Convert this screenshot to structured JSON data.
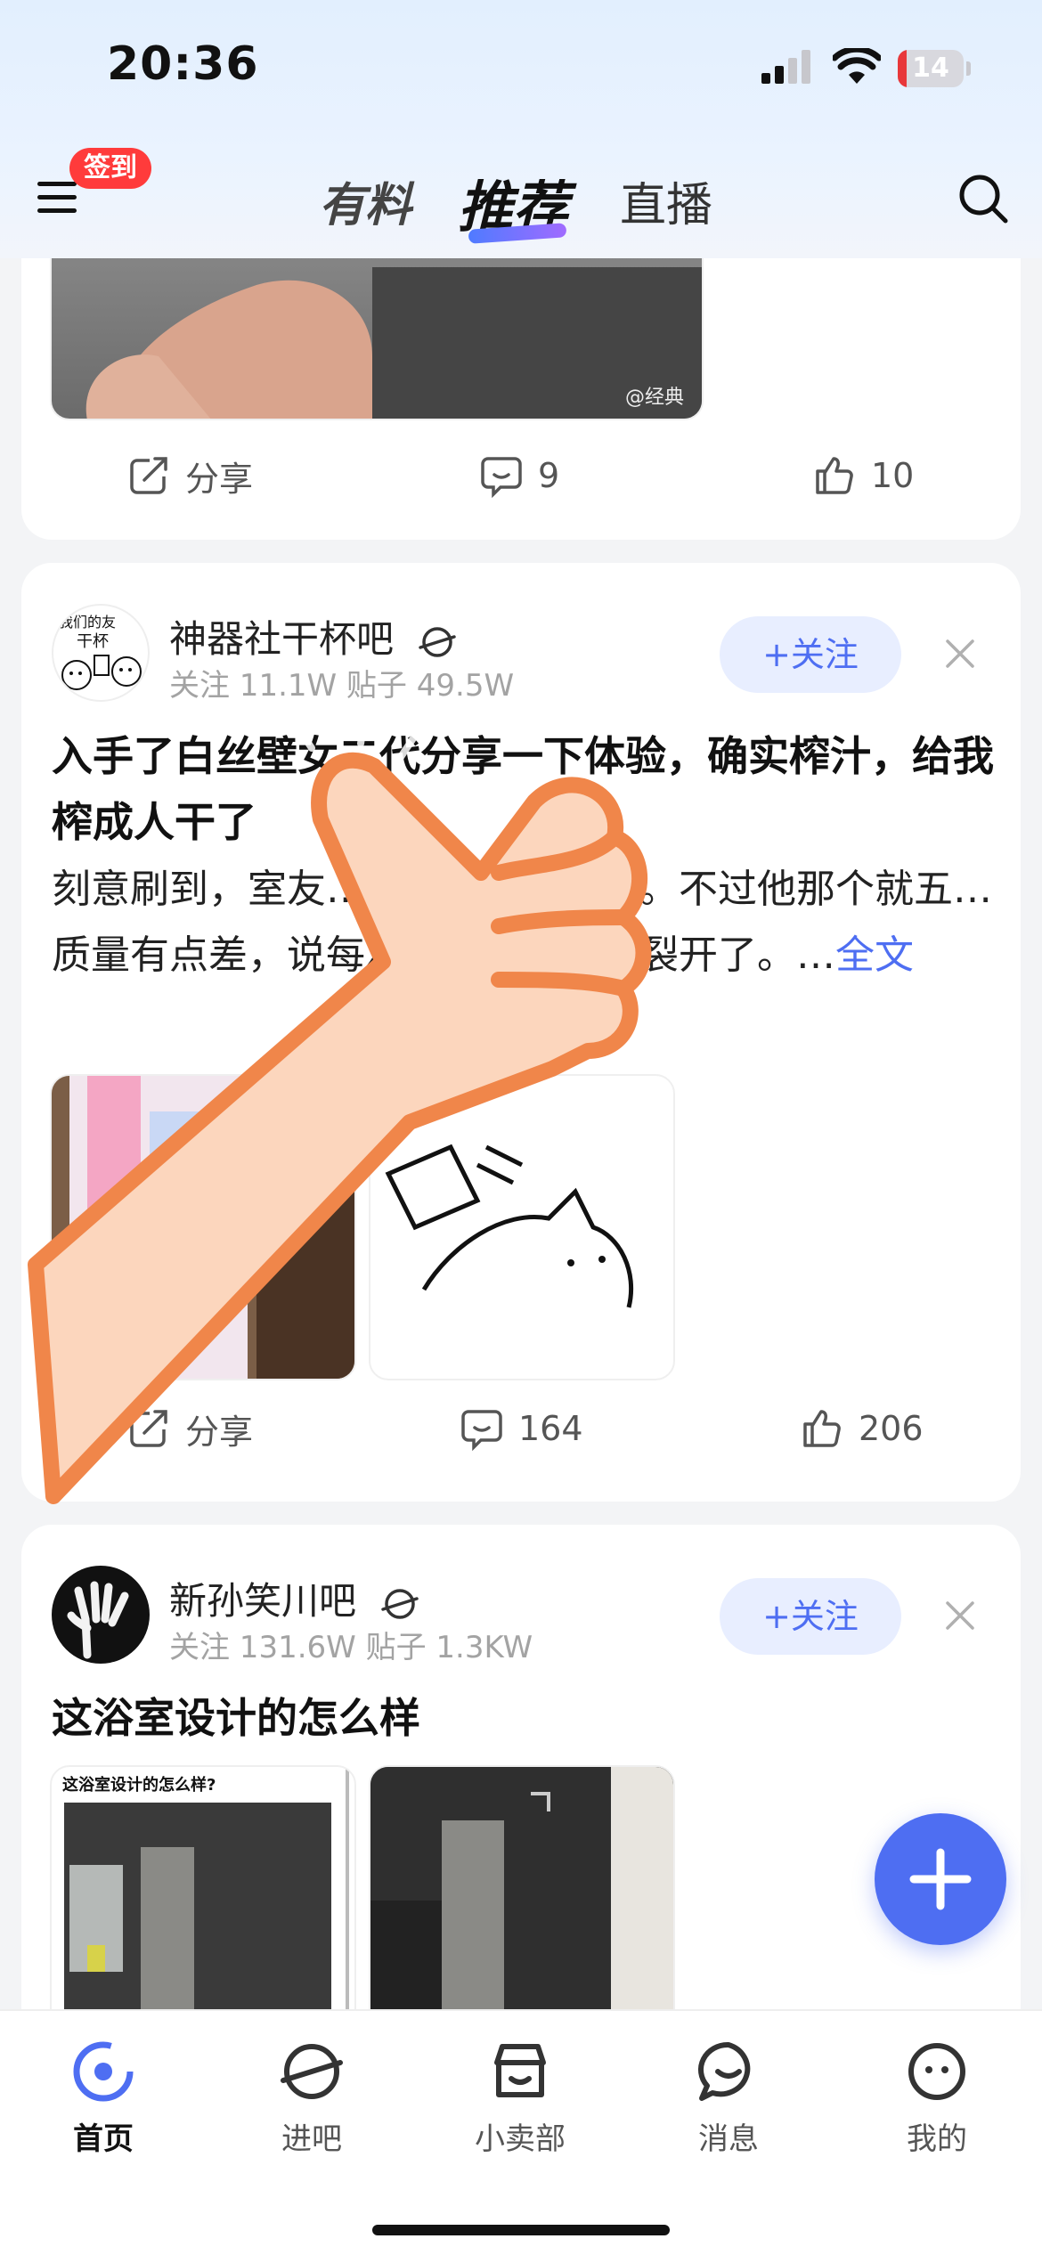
{
  "status_bar": {
    "time": "20:36",
    "battery": "14",
    "battery_level": 0.14
  },
  "nav": {
    "signin_badge": "签到",
    "tabs": [
      {
        "label": "有料",
        "active": false
      },
      {
        "label": "推荐",
        "active": true
      },
      {
        "label": "直播",
        "active": false
      }
    ]
  },
  "feed": {
    "card1": {
      "image_watermark": "@经典",
      "actions": {
        "share": "分享",
        "comments": "9",
        "likes": "10"
      }
    },
    "card2": {
      "forum_name": "神器社干杯吧",
      "stats": "关注 11.1W  贴子 49.5W",
      "follow_label": "+关注",
      "title": "入手了白丝壁女二代分享一下体验，确实榨汁，给我榨成人干了",
      "body": "刻意刷到，室友…感觉也挺好用的。不过他那个就五…质量有点差，说每次洗都掉渣…点裂开了。…",
      "more_link": "全文",
      "actions": {
        "share": "分享",
        "comments": "164",
        "likes": "206"
      }
    },
    "card3": {
      "forum_name": "新孙笑川吧",
      "stats": "关注 131.6W  贴子 1.3KW",
      "follow_label": "+关注",
      "title": "这浴室设计的怎么样",
      "image_caption": "这浴室设计的怎么样?"
    }
  },
  "tabbar": {
    "items": [
      {
        "label": "首页",
        "icon": "home-icon",
        "active": true
      },
      {
        "label": "进吧",
        "icon": "planet-icon",
        "active": false
      },
      {
        "label": "小卖部",
        "icon": "shop-icon",
        "active": false
      },
      {
        "label": "消息",
        "icon": "message-icon",
        "active": false
      },
      {
        "label": "我的",
        "icon": "profile-icon",
        "active": false
      }
    ]
  },
  "colors": {
    "accent": "#4e6ef2",
    "badge_red": "#ff3b3b",
    "overlay_orange": "#f0864a"
  }
}
